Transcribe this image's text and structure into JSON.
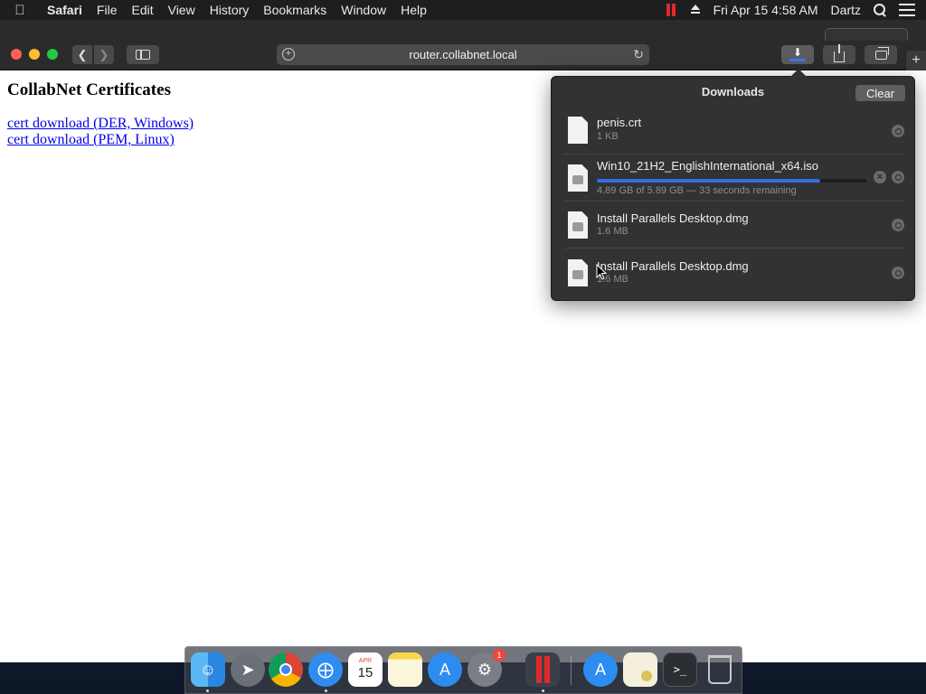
{
  "menubar": {
    "app_name": "Safari",
    "items": [
      "File",
      "Edit",
      "View",
      "History",
      "Bookmarks",
      "Window",
      "Help"
    ],
    "clock": "Fri Apr 15  4:58 AM",
    "user": "Dartz"
  },
  "browser": {
    "url": "router.collabnet.local"
  },
  "page": {
    "heading": "CollabNet Certificates",
    "links": [
      "cert download (DER, Windows)",
      "cert download (PEM, Linux)"
    ]
  },
  "downloads": {
    "title": "Downloads",
    "clear_label": "Clear",
    "items": [
      {
        "name": "penis.crt",
        "detail": "1 KB"
      },
      {
        "name": "Win10_21H2_EnglishInternational_x64.iso",
        "detail": "4.89 GB of 5.89 GB — 33 seconds remaining",
        "progress": 0.83
      },
      {
        "name": "Install Parallels Desktop.dmg",
        "detail": "1.6 MB"
      },
      {
        "name": "Install Parallels Desktop.dmg",
        "detail": "1.6 MB"
      }
    ]
  },
  "dock": {
    "apps": [
      "finder-icon",
      "launchpad-icon",
      "chrome-icon",
      "safari-icon",
      "calendar-icon",
      "notes-icon",
      "app-store-icon",
      "system-preferences-icon",
      "parallels-icon",
      "app-store-download-icon",
      "certificate-file-icon",
      "terminal-icon",
      "trash-icon"
    ],
    "calendar_month": "APR",
    "calendar_day": "15",
    "sys_prefs_badge": "1"
  }
}
